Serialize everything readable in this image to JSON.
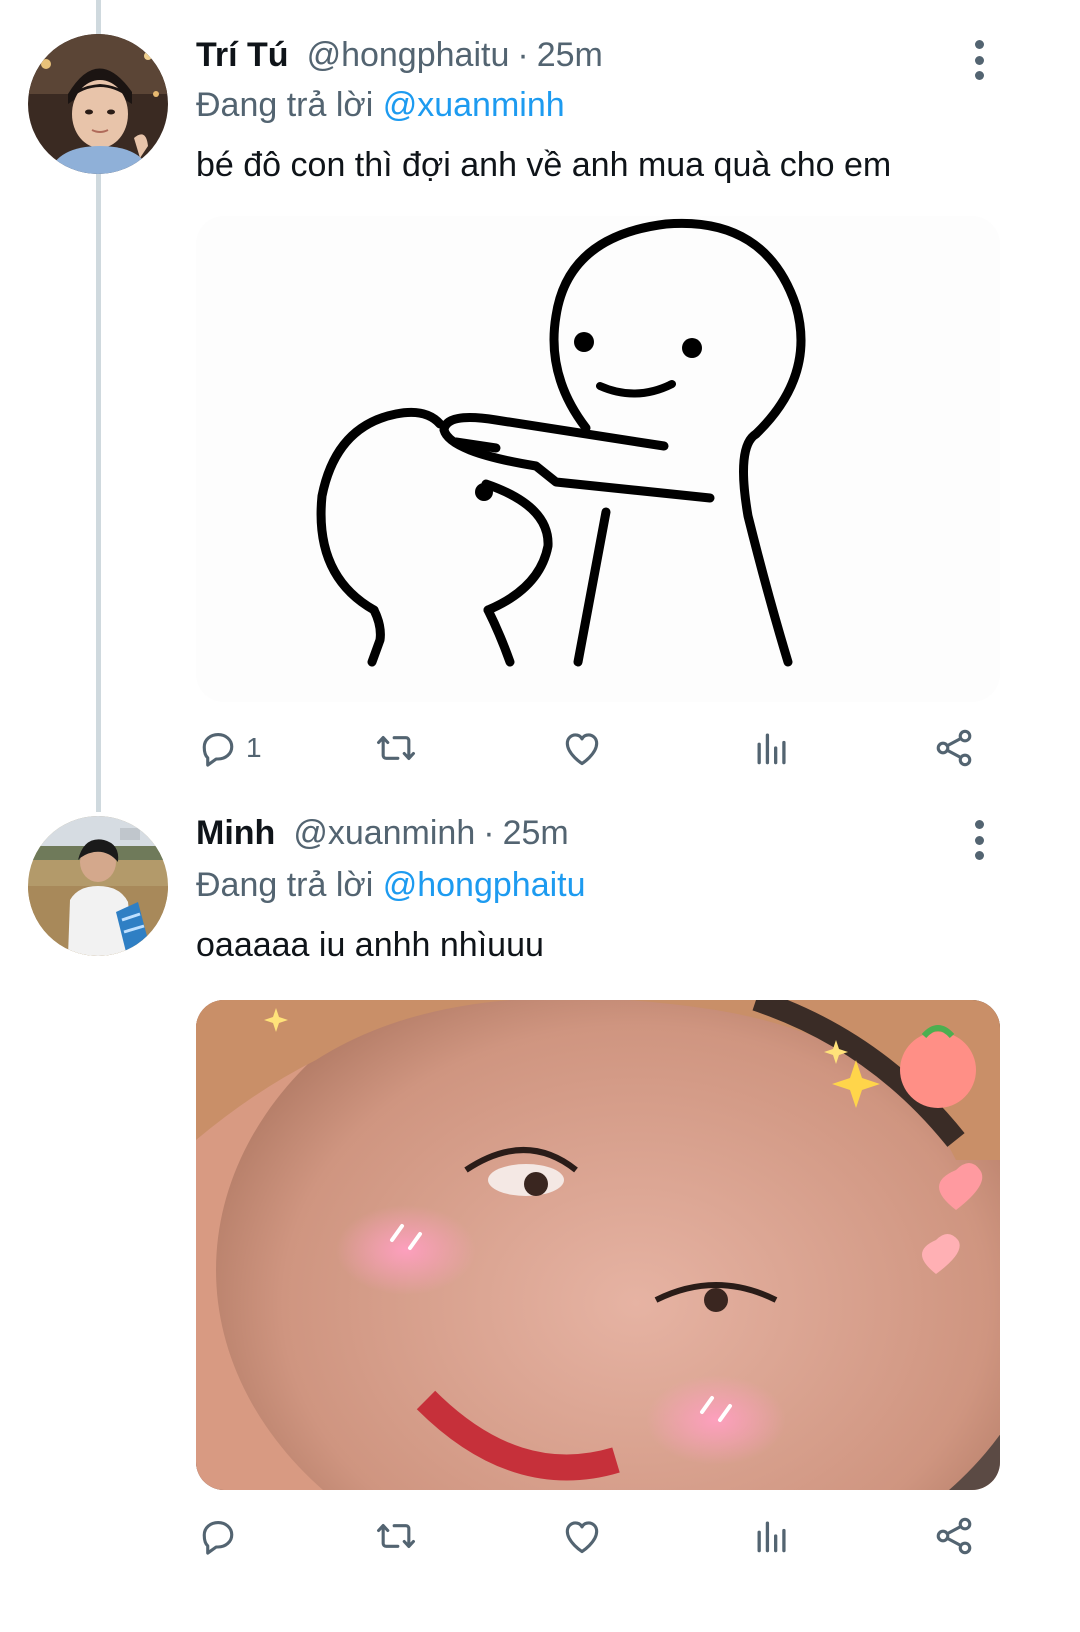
{
  "tweets": [
    {
      "name": "Trí Tú",
      "handle": "@hongphaitu",
      "separator": "·",
      "time": "25m",
      "replying_prefix": "Đang trả lời",
      "replying_to": "@xuanminh",
      "text": "bé đô con thì đợi anh về anh mua quà cho em",
      "reply_count": "1"
    },
    {
      "name": "Minh",
      "handle": "@xuanminh",
      "separator": "·",
      "time": "25m",
      "replying_prefix": "Đang trả lời",
      "replying_to": "@hongphaitu",
      "text": "oaaaaa iu anhh nhìuuu",
      "reply_count": ""
    }
  ],
  "colors": {
    "link": "#1d9bf0",
    "secondary_text": "#536471",
    "thread_line": "#cfd9de"
  },
  "icons": [
    "more-vertical-icon",
    "reply-icon",
    "retweet-icon",
    "like-icon",
    "stats-icon",
    "share-icon"
  ]
}
